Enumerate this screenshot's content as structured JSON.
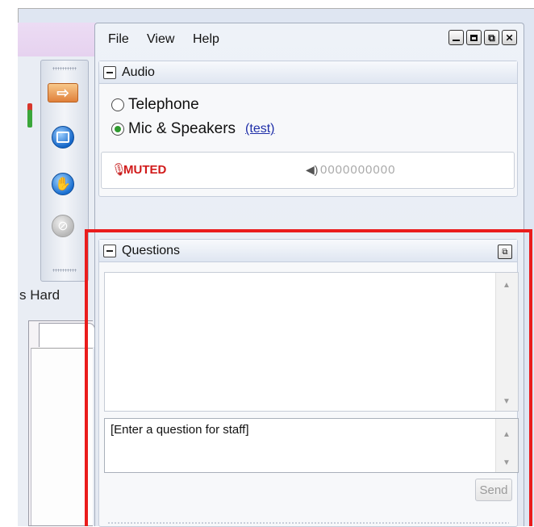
{
  "menu": {
    "file": "File",
    "view": "View",
    "help": "Help"
  },
  "audio": {
    "title": "Audio",
    "telephone_label": "Telephone",
    "mic_speakers_label": "Mic & Speakers",
    "test_link": "(test)",
    "selected_option": "Mic & Speakers",
    "muted_label": "MUTED",
    "level_meter": "0000000000"
  },
  "questions": {
    "title": "Questions",
    "input_placeholder": "[Enter a question for staff]",
    "send_label": "Send"
  },
  "background": {
    "fragment_text": "s Hard"
  },
  "colors": {
    "highlight": "#ea1c1c",
    "muted": "#d11a1a",
    "link": "#1f2fa8",
    "selected_radio": "#2f9a2f"
  },
  "icons": [
    "arrow-icon",
    "stop-icon",
    "raise-hand-icon",
    "disabled-icon",
    "microphone-icon",
    "speaker-icon",
    "minimize-icon",
    "maximize-icon",
    "popout-icon",
    "close-icon"
  ]
}
